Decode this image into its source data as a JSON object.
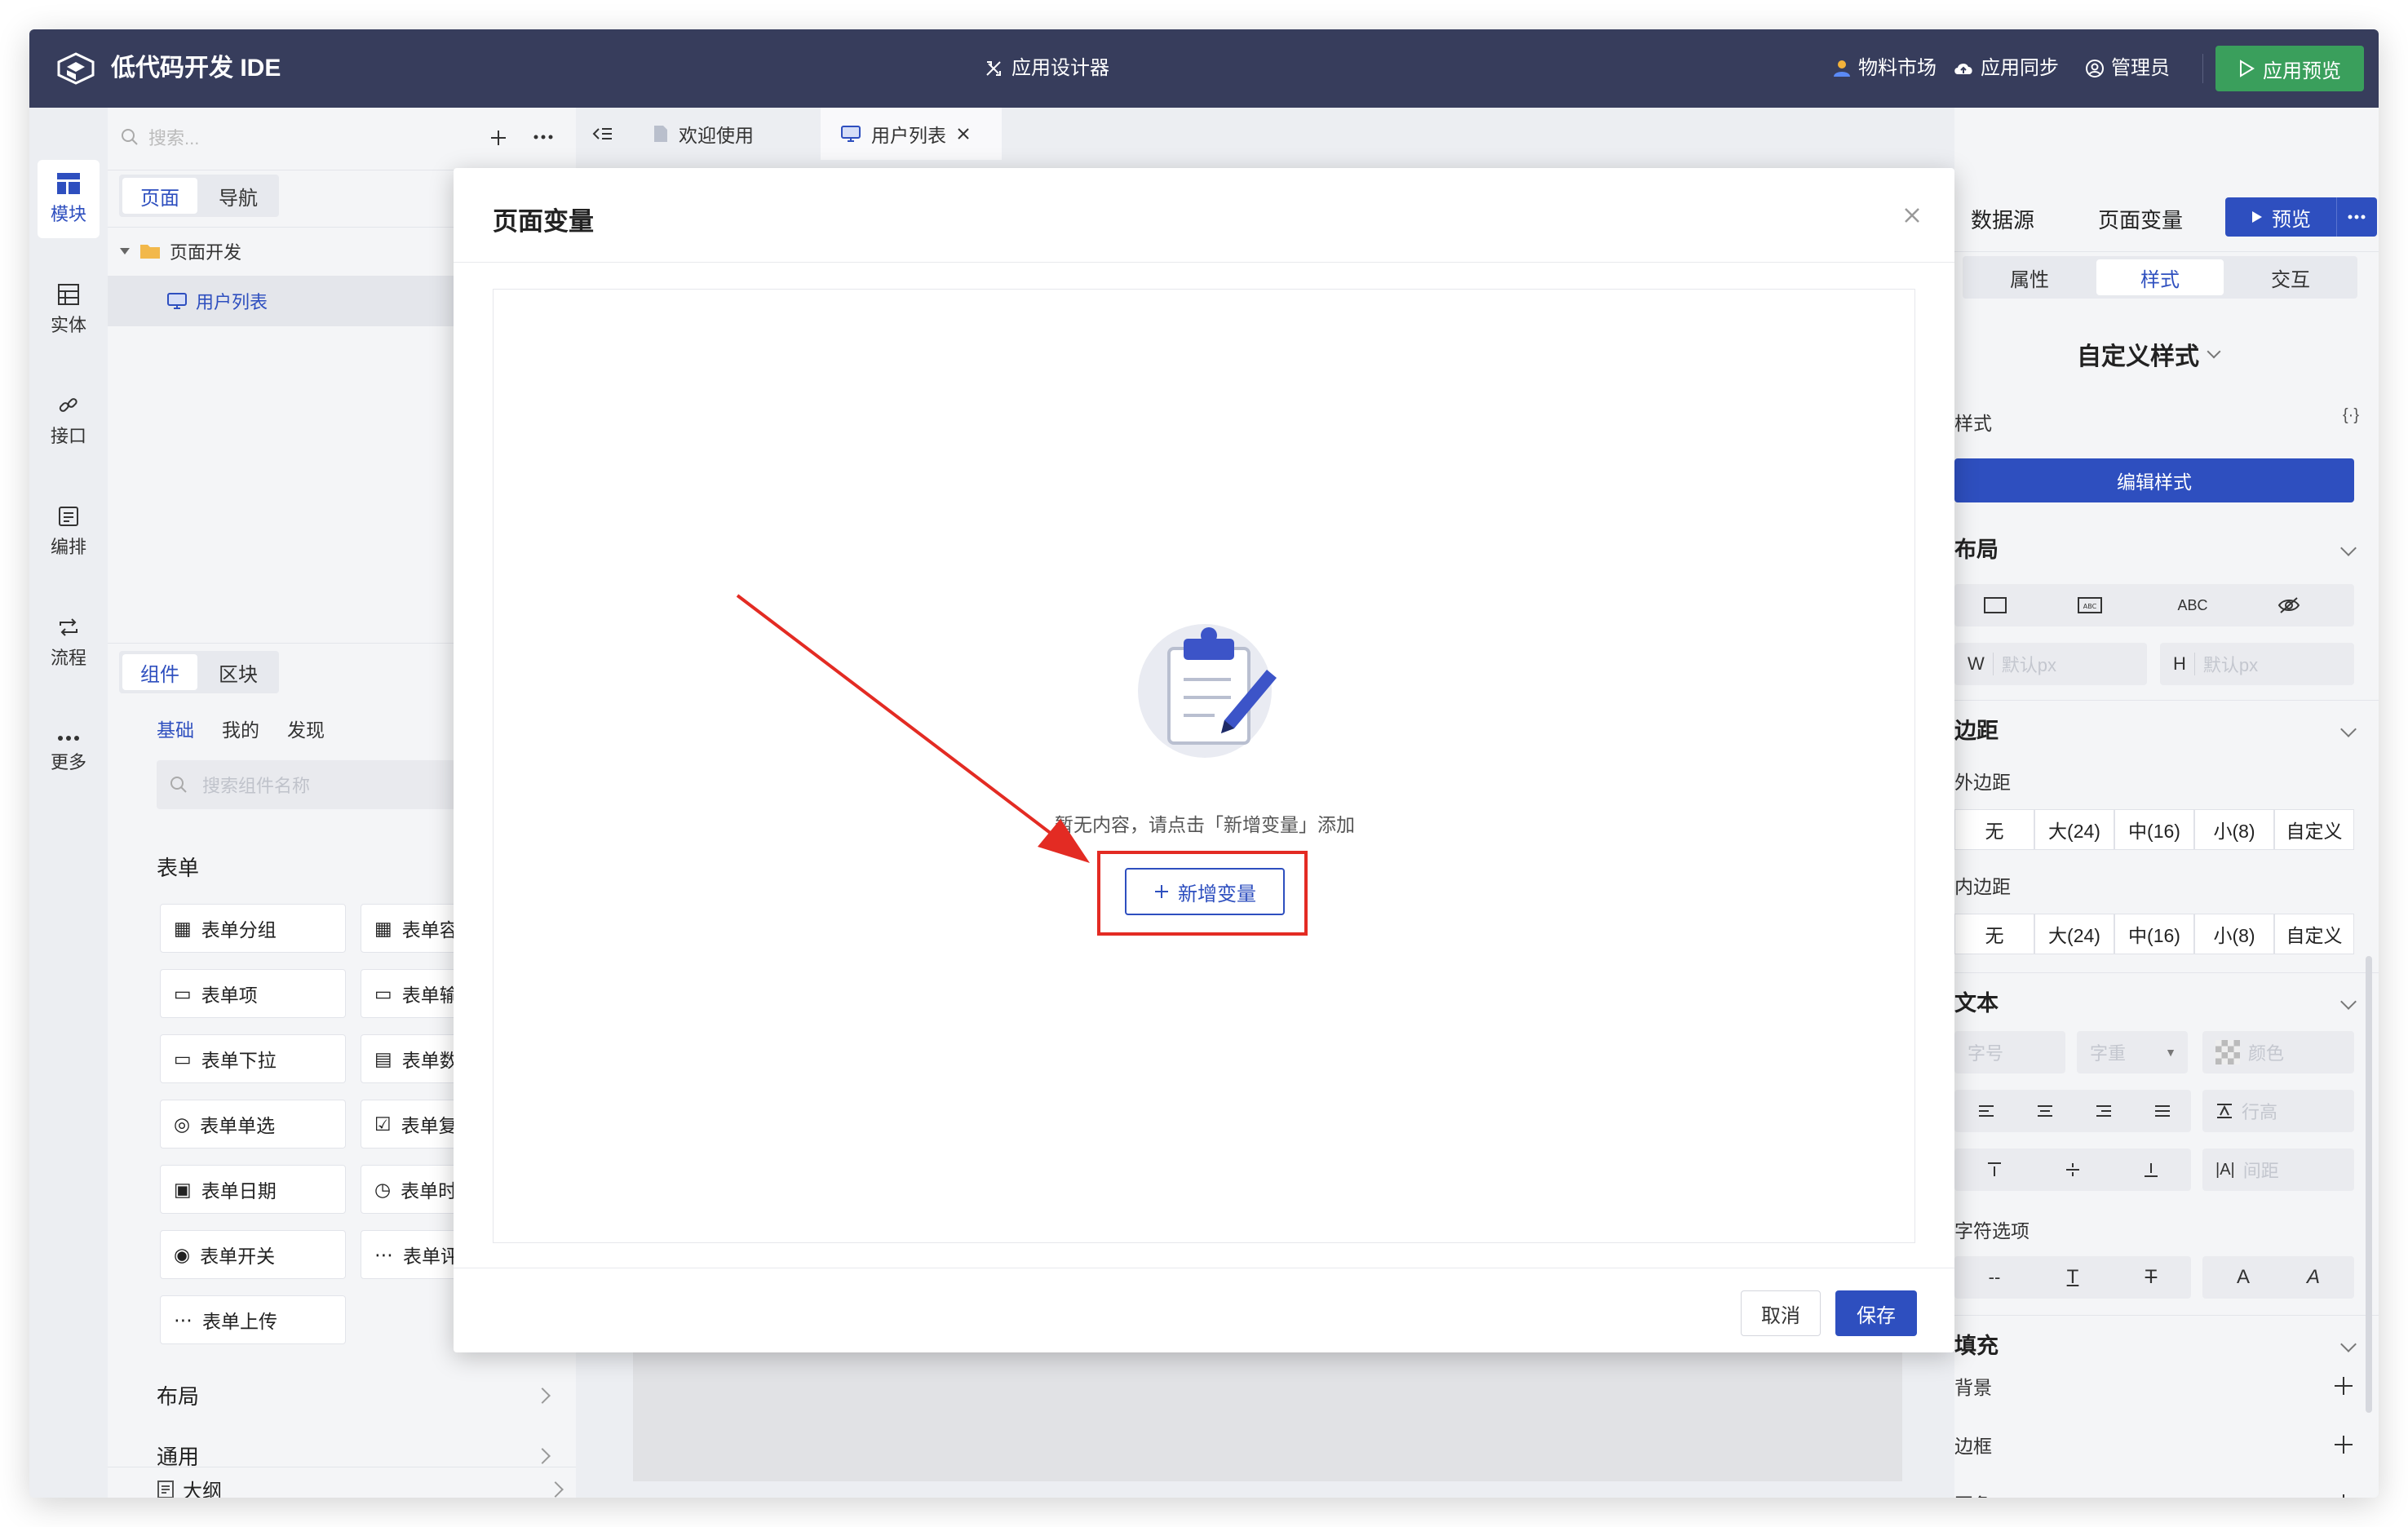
{
  "header": {
    "app_title": "低代码开发 IDE",
    "center_title": "应用设计器",
    "material_market": "物料市场",
    "app_sync": "应用同步",
    "admin": "管理员",
    "app_preview": "应用预览"
  },
  "iconbar": {
    "items": [
      {
        "label": "模块"
      },
      {
        "label": "实体"
      },
      {
        "label": "接口"
      },
      {
        "label": "编排"
      },
      {
        "label": "流程"
      },
      {
        "label": "更多"
      }
    ]
  },
  "left": {
    "search_placeholder": "搜索...",
    "tabs": [
      "页面",
      "导航"
    ],
    "tree": {
      "folder": "页面开发",
      "page": "用户列表"
    },
    "comp_tabs": [
      "组件",
      "区块"
    ],
    "sub_tabs": [
      "基础",
      "我的",
      "发现"
    ],
    "comp_search_placeholder": "搜索组件名称",
    "form_section": "表单",
    "components": [
      "表单分组",
      "表单容器",
      "表单项",
      "表单输入",
      "表单下拉",
      "表单数字",
      "表单单选",
      "表单复选",
      "表单日期",
      "表单时间",
      "表单开关",
      "表单评分",
      "表单上传"
    ],
    "layout_section": "布局",
    "common_section": "通用",
    "outline": "大纲"
  },
  "tabs": {
    "welcome": "欢迎使用",
    "user_list": "用户列表"
  },
  "right": {
    "datasource": "数据源",
    "page_vars": "页面变量",
    "preview": "预览",
    "tabs": [
      "属性",
      "样式",
      "交互"
    ],
    "custom_style": "自定义样式",
    "style_label": "样式",
    "edit_style": "编辑样式",
    "layout": "布局",
    "w_label": "W",
    "h_label": "H",
    "w_placeholder": "默认px",
    "h_placeholder": "默认px",
    "abc_label": "ABC",
    "spacing": "边距",
    "margin": "外边距",
    "padding": "内边距",
    "spacing_opts": [
      "无",
      "大(24)",
      "中(16)",
      "小(8)",
      "自定义"
    ],
    "text": "文本",
    "font_size": "字号",
    "font_weight": "字重",
    "color": "颜色",
    "line_height": "行高",
    "letter_spacing": "间距",
    "char_options": "字符选项",
    "fill": "填充",
    "background": "背景",
    "border": "边框",
    "radius": "圆角"
  },
  "modal": {
    "title": "页面变量",
    "empty_text": "暂无内容，请点击「新增变量」添加",
    "add_button": "新增变量",
    "cancel": "取消",
    "save": "保存"
  },
  "colors": {
    "header_bg": "#373d5c",
    "accent": "#2e4fbf",
    "success": "#3a9f5c",
    "highlight": "#e32b23"
  }
}
